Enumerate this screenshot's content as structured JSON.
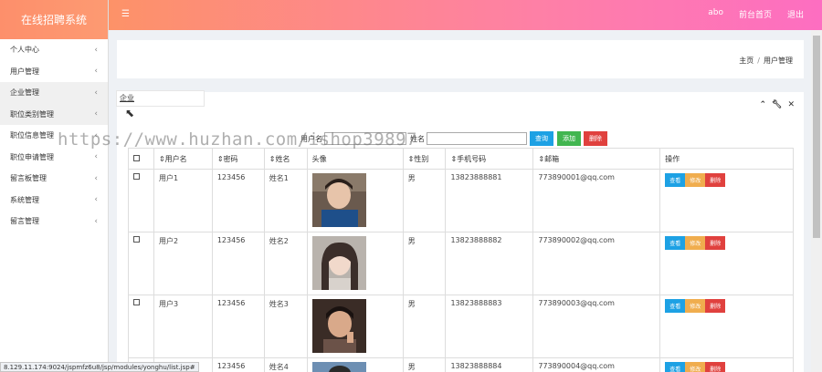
{
  "sidebar": {
    "title": "在线招聘系统",
    "items": [
      {
        "label": "个人中心"
      },
      {
        "label": "用户管理"
      },
      {
        "label": "企业管理"
      },
      {
        "label": "职位类别管理"
      },
      {
        "label": "职位信息管理"
      },
      {
        "label": "职位申请管理"
      },
      {
        "label": "留言板管理"
      },
      {
        "label": "系统管理"
      },
      {
        "label": "留言管理"
      }
    ],
    "chevron": "‹"
  },
  "topbar": {
    "menu_icon": "hamburger-icon",
    "links": [
      "abo",
      "前台首页",
      "退出"
    ]
  },
  "breadcrumb": {
    "home": "主页",
    "separator": "/",
    "current": "用户管理"
  },
  "tooltip": {
    "text": "企业"
  },
  "search": {
    "username_label": "用户名",
    "name_label": "姓名",
    "username_value": "",
    "name_value": "",
    "query": "查询",
    "add": "添加",
    "delete": "删除"
  },
  "table": {
    "headers": [
      "用户名",
      "密码",
      "姓名",
      "头像",
      "性别",
      "手机号码",
      "邮箱",
      "操作"
    ],
    "rows": [
      {
        "username": "用户1",
        "password": "123456",
        "name": "姓名1",
        "gender": "男",
        "phone": "13823888881",
        "email": "773890001@qq.com"
      },
      {
        "username": "用户2",
        "password": "123456",
        "name": "姓名2",
        "gender": "男",
        "phone": "13823888882",
        "email": "773890002@qq.com"
      },
      {
        "username": "用户3",
        "password": "123456",
        "name": "姓名3",
        "gender": "男",
        "phone": "13823888883",
        "email": "773890003@qq.com"
      },
      {
        "username": "用户4",
        "password": "123456",
        "name": "姓名4",
        "gender": "男",
        "phone": "13823888884",
        "email": "773890004@qq.com"
      }
    ],
    "ops": {
      "view": "查看",
      "edit": "修改",
      "delete": "删除"
    }
  },
  "watermark": "https://www.huzhan.com/ishop39897",
  "statusbar": "8.129.11.174:9024/jspmfz6u8/jsp/modules/yonghu/list.jsp#",
  "colors": {
    "accent_start": "#fd9268",
    "accent_end": "#fd6ec1",
    "blue": "#1da1e4",
    "green": "#42b650",
    "red": "#e0413e",
    "orange": "#f0ad4e"
  }
}
